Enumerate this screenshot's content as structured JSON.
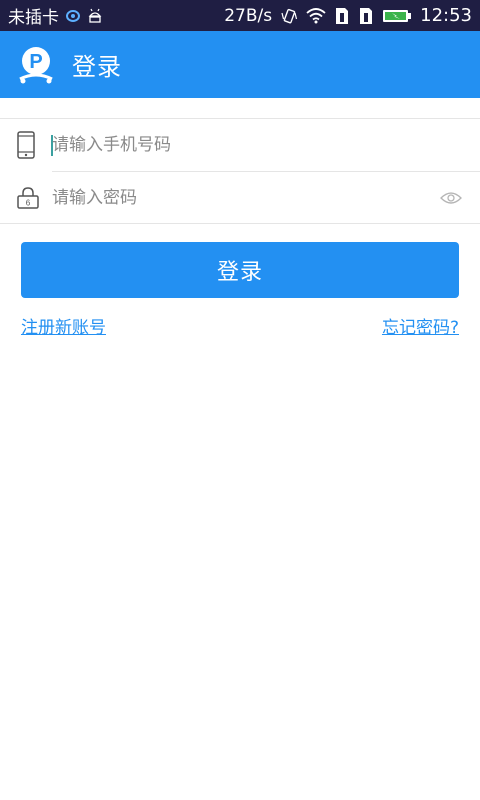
{
  "status_bar": {
    "carrier": "未插卡",
    "speed": "27B/s",
    "time": "12:53",
    "icons": [
      "sync-icon",
      "android-icon",
      "vibrate-icon",
      "wifi-icon",
      "sim-icon-1",
      "sim-icon-2",
      "battery-icon"
    ]
  },
  "app_bar": {
    "title": "登录",
    "logo": "parking-logo-icon"
  },
  "form": {
    "phone_placeholder": "请输入手机号码",
    "phone_value": "",
    "password_placeholder": "请输入密码",
    "password_value": "",
    "phone_icon": "phone-icon",
    "password_icon": "lock-icon",
    "eye_icon": "eye-icon"
  },
  "login_button_label": "登录",
  "links": {
    "register": "注册新账号",
    "forgot": "忘记密码?"
  },
  "colors": {
    "status_bar": "#1f1e43",
    "primary": "#2390f2",
    "divider": "#e5e5e5",
    "placeholder": "#8a8a8a"
  }
}
